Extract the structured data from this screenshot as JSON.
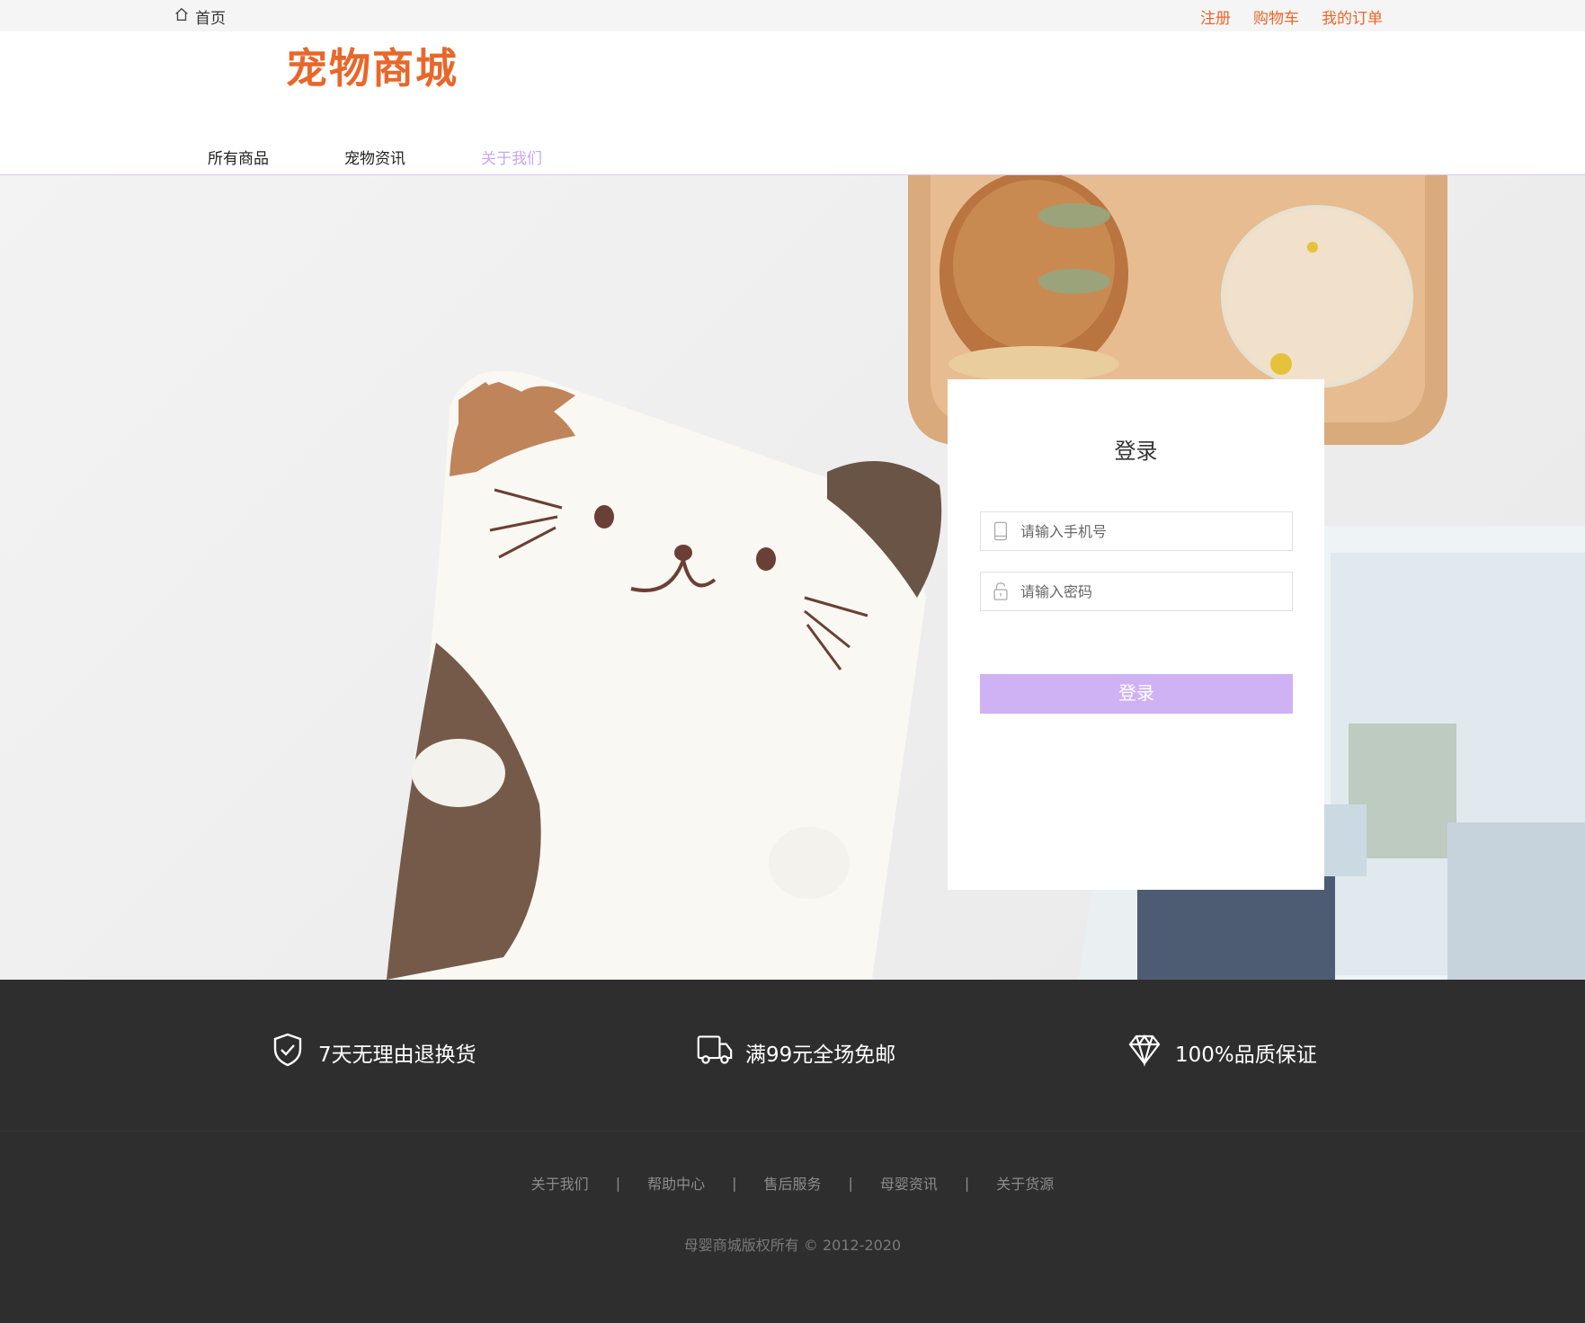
{
  "topbar": {
    "home_label": "首页",
    "links": [
      "注册",
      "购物车",
      "我的订单"
    ]
  },
  "header": {
    "logo_text": "宠物商城"
  },
  "nav": {
    "items": [
      "所有商品",
      "宠物资讯",
      "关于我们"
    ],
    "active_index": 2
  },
  "login": {
    "title": "登录",
    "phone_placeholder": "请输入手机号",
    "password_placeholder": "请输入密码",
    "submit_label": "登录"
  },
  "footer": {
    "features": [
      "7天无理由退换货",
      "满99元全场免邮",
      "100%品质保证"
    ],
    "links": [
      "关于我们",
      "帮助中心",
      "售后服务",
      "母婴资讯",
      "关于货源"
    ],
    "separator": "|",
    "copyright": "母婴商城版权所有 © 2012-2020"
  },
  "colors": {
    "brand_orange": "#e8672a",
    "accent_purple": "#cfb2f3",
    "footer_bg": "#2e2e2e"
  },
  "icons": {
    "home": "home-icon",
    "phone": "mobile-phone-icon",
    "lock": "lock-icon",
    "shield": "shield-check-icon",
    "truck": "truck-icon",
    "diamond": "diamond-icon"
  }
}
